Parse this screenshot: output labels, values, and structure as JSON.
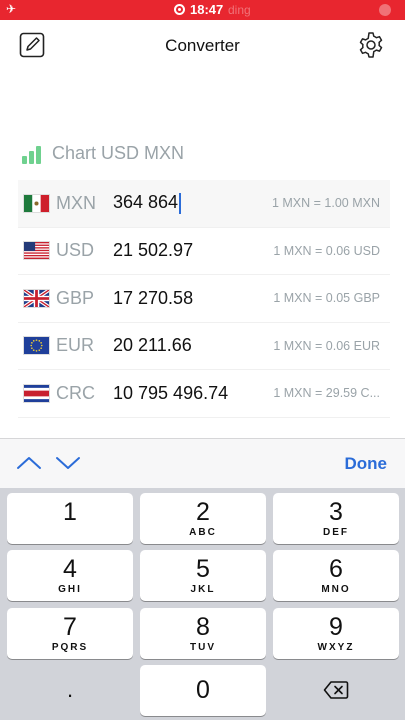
{
  "status": {
    "time": "18:47",
    "ghost_text": "ding"
  },
  "nav": {
    "title": "Converter"
  },
  "chart": {
    "label": "Chart USD MXN"
  },
  "currencies": [
    {
      "code": "MXN",
      "amount": "364 864",
      "rate": "1 MXN = 1.00 MXN",
      "active": true
    },
    {
      "code": "USD",
      "amount": "21 502.97",
      "rate": "1 MXN = 0.06 USD"
    },
    {
      "code": "GBP",
      "amount": "17 270.58",
      "rate": "1 MXN = 0.05 GBP"
    },
    {
      "code": "EUR",
      "amount": "20 211.66",
      "rate": "1 MXN = 0.06 EUR"
    },
    {
      "code": "CRC",
      "amount": "10 795 496.74",
      "rate": "1 MXN = 29.59 C..."
    }
  ],
  "accessory": {
    "done_label": "Done"
  },
  "keypad": {
    "keys": [
      {
        "num": "1",
        "letters": ""
      },
      {
        "num": "2",
        "letters": "ABC"
      },
      {
        "num": "3",
        "letters": "DEF"
      },
      {
        "num": "4",
        "letters": "GHI"
      },
      {
        "num": "5",
        "letters": "JKL"
      },
      {
        "num": "6",
        "letters": "MNO"
      },
      {
        "num": "7",
        "letters": "PQRS"
      },
      {
        "num": "8",
        "letters": "TUV"
      },
      {
        "num": "9",
        "letters": "WXYZ"
      },
      {
        "num": ".",
        "letters": ""
      },
      {
        "num": "0",
        "letters": ""
      }
    ]
  },
  "colors": {
    "status_bar": "#e8262f",
    "accent": "#2b6cd8",
    "chart_green": "#6fd18f",
    "muted": "#9aa3a8"
  }
}
